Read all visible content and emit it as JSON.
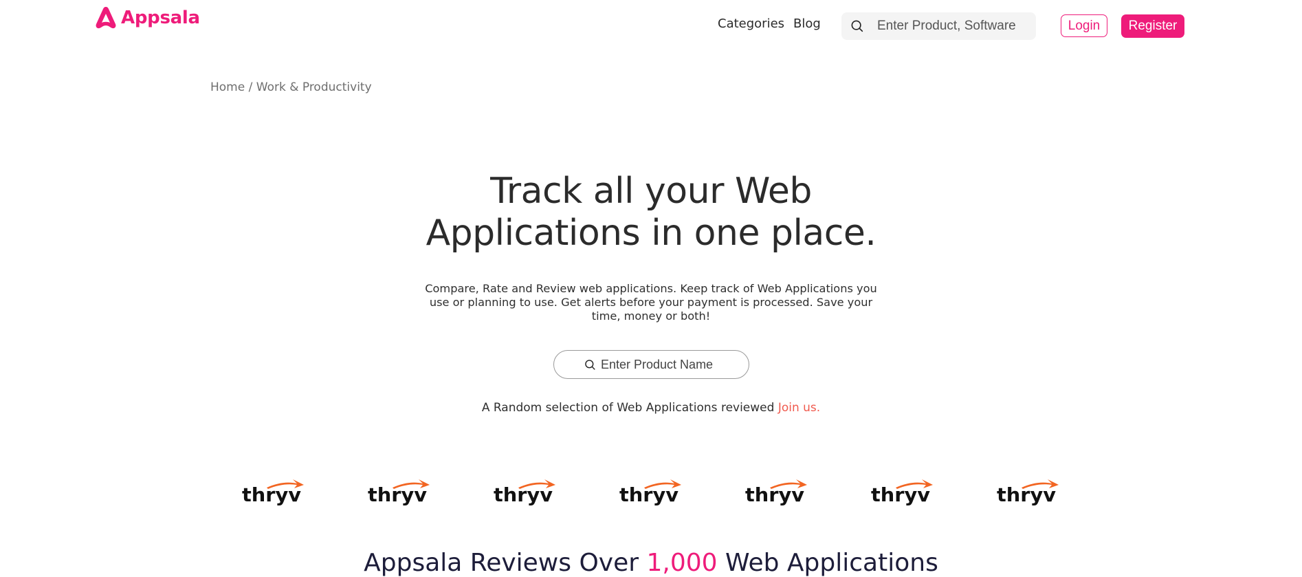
{
  "brand": {
    "name": "Appsala",
    "color": "#ee1c7a"
  },
  "nav": {
    "categories": "Categories",
    "blog": "Blog"
  },
  "header_search": {
    "placeholder": "Enter Product, Software",
    "icon": "search-icon"
  },
  "auth": {
    "login_label": "Login",
    "register_label": "Register"
  },
  "breadcrumb": {
    "home": "Home",
    "separator": " / ",
    "current": "Work & Productivity"
  },
  "hero": {
    "title_line1": "Track all your Web",
    "title_line2": "Applications in one place.",
    "description": "Compare, Rate and Review web applications. Keep track of Web Applications you use or planning to use. Get alerts before your payment is processed. Save your time, money or both!",
    "search_placeholder": "Enter Product Name",
    "random_text": "A Random selection of Web Applications reviewed ",
    "join_label": "Join us."
  },
  "app_logos": [
    {
      "name": "thryv"
    },
    {
      "name": "thryv"
    },
    {
      "name": "thryv"
    },
    {
      "name": "thryv"
    },
    {
      "name": "thryv"
    },
    {
      "name": "thryv"
    },
    {
      "name": "thryv"
    }
  ],
  "section": {
    "heading_prefix": "Appsala Reviews Over ",
    "heading_count": "1,000",
    "heading_suffix": " Web Applications"
  },
  "colors": {
    "accent": "#ee1c7a",
    "join_link": "#f05a4e",
    "logo_arrow": "#f26522"
  }
}
